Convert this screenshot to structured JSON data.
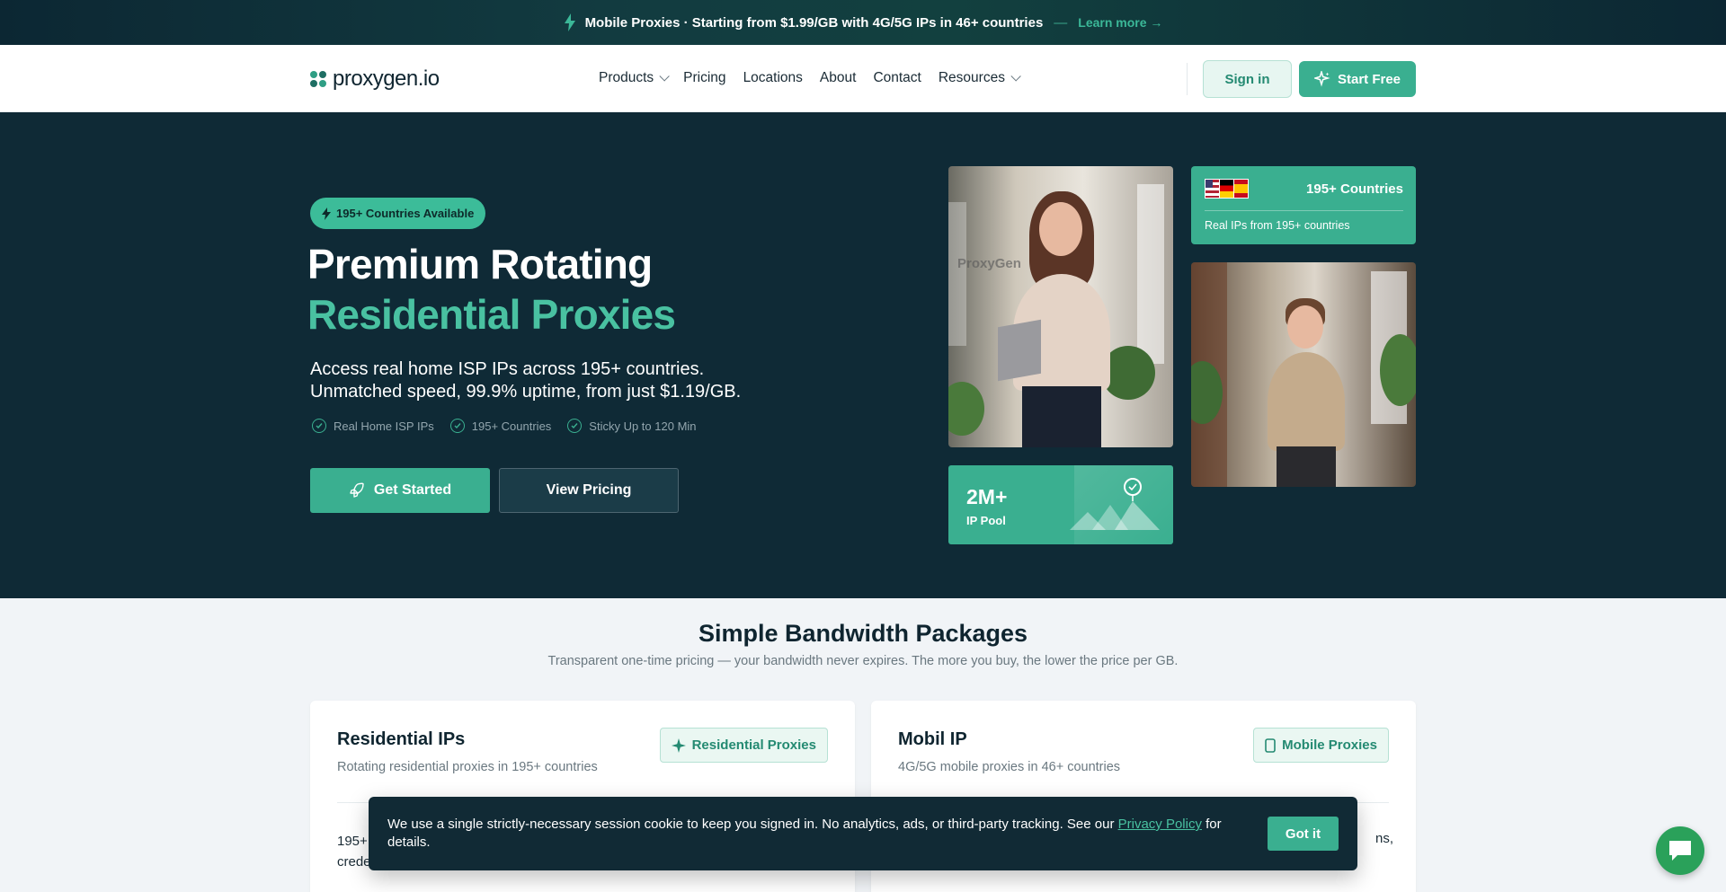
{
  "announcement": {
    "icon": "bolt-icon",
    "text": "Mobile Proxies · Starting from $1.99/GB with 4G/5G IPs in 46+ countries",
    "separator": "—",
    "link": "Learn more →"
  },
  "nav": {
    "logo_text": "proxygen.io",
    "links": [
      {
        "label": "Products",
        "dropdown": true
      },
      {
        "label": "Pricing"
      },
      {
        "label": "Locations"
      },
      {
        "label": "About"
      },
      {
        "label": "Contact"
      },
      {
        "label": "Resources",
        "dropdown": true
      }
    ],
    "signin": "Sign in",
    "start_free": "Start Free"
  },
  "hero": {
    "badge": "195+ Countries Available",
    "title_line1": "Premium Rotating",
    "title_line2": "Residential Proxies",
    "subtitle_line1": "Access real home ISP IPs across 195+ countries.",
    "subtitle_line2": "Unmatched speed, 99.9% uptime, from just $1.19/GB.",
    "features": [
      "Real Home ISP IPs",
      "195+ Countries",
      "Sticky Up to 120 Min"
    ],
    "btn_primary": "Get Started",
    "btn_secondary": "View Pricing",
    "countries_card": {
      "title": "195+ Countries",
      "subtitle": "Real IPs from 195+ countries"
    },
    "pool_card": {
      "value": "2M+",
      "label": "IP Pool"
    },
    "photo_wall_text": "ProxyGen"
  },
  "packages": {
    "title": "Simple Bandwidth Packages",
    "subtitle": "Transparent one-time pricing — your bandwidth never expires. The more you buy, the lower the price per GB.",
    "cards": [
      {
        "title": "Residential IPs",
        "subtitle": "Rotating residential proxies in 195+ countries",
        "tag": "Residential Proxies",
        "body_line1": "195+",
        "body_line2": "crede"
      },
      {
        "title": "Mobil IP",
        "subtitle": "4G/5G mobile proxies in 46+ countries",
        "tag": "Mobile Proxies",
        "body_right": "ns,"
      }
    ]
  },
  "cookie": {
    "text_before": "We use a single strictly-necessary session cookie to keep you signed in. No analytics, ads, or third-party tracking. See our ",
    "link": "Privacy Policy",
    "text_after": " for details.",
    "button": "Got it"
  },
  "colors": {
    "accent": "#3aaf90",
    "hero_bg": "#0f2a36",
    "accent_text": "#49c1a1"
  }
}
